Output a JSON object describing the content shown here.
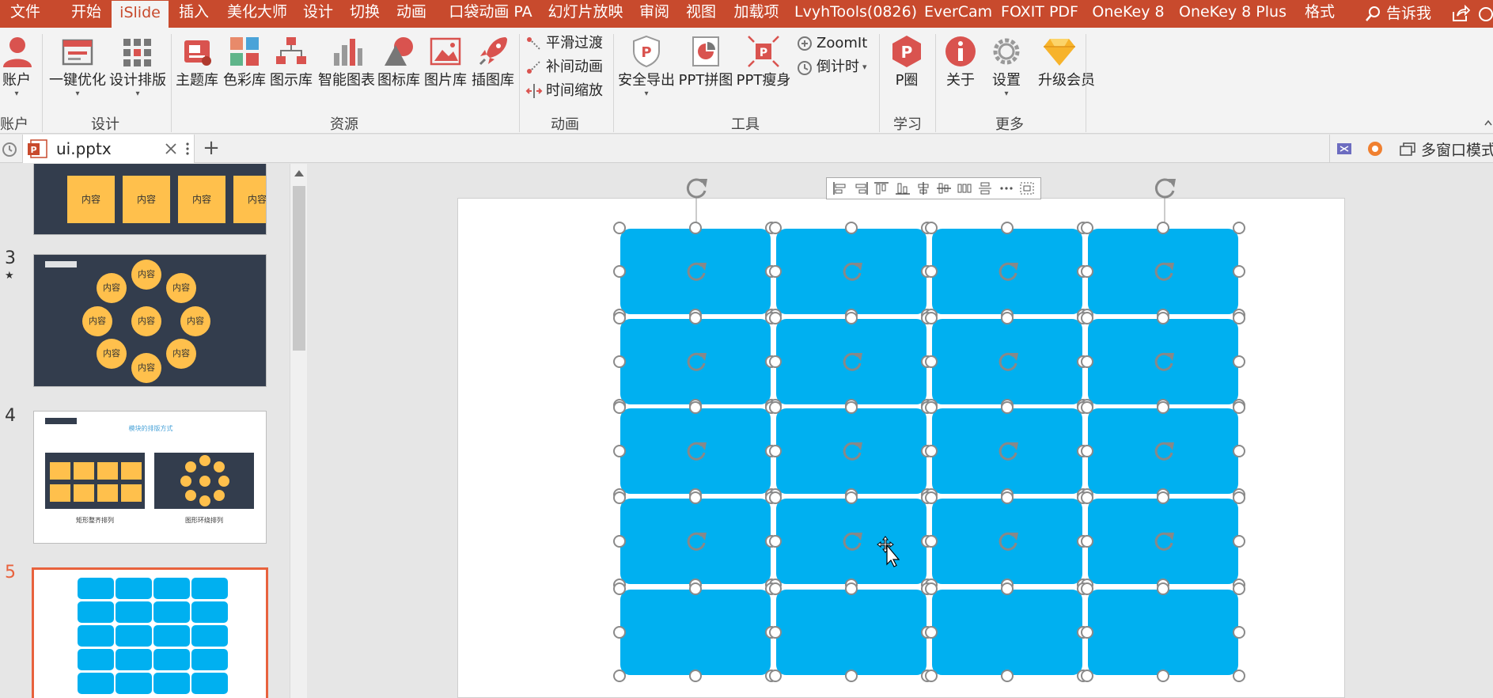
{
  "menu": {
    "tabs": [
      "文件",
      "开始",
      "iSlide",
      "插入",
      "美化大师",
      "设计",
      "切换",
      "动画",
      "口袋动画 PA",
      "幻灯片放映",
      "审阅",
      "视图",
      "加载项",
      "LvyhTools(0826)",
      "EverCam",
      "FOXIT PDF",
      "OneKey 8",
      "OneKey 8 Plus",
      "格式"
    ],
    "active": "iSlide",
    "tell_me": "告诉我"
  },
  "ribbon": {
    "account": {
      "label": "账户",
      "group": "账户"
    },
    "design": {
      "buttons": [
        "一键优化",
        "设计排版"
      ],
      "group": "设计"
    },
    "resources": {
      "buttons": [
        "主题库",
        "色彩库",
        "图示库",
        "智能图表",
        "图标库",
        "图片库",
        "插图库"
      ],
      "group": "资源"
    },
    "animation": {
      "items": [
        "平滑过渡",
        "补间动画",
        "时间缩放"
      ],
      "group": "动画"
    },
    "tools": {
      "buttons": [
        "安全导出",
        "PPT拼图",
        "PPT瘦身"
      ],
      "small": [
        "ZoomIt",
        "倒计时"
      ],
      "group": "工具"
    },
    "learn": {
      "buttons": [
        "P圈"
      ],
      "group": "学习"
    },
    "more": {
      "buttons": [
        "关于",
        "设置",
        "升级会员"
      ],
      "group": "更多"
    }
  },
  "tabbar": {
    "doc_name": "ui.pptx",
    "add": "+",
    "multi_window": "多窗口模式"
  },
  "thumbnails": {
    "content_label": "内容",
    "slides": [
      {
        "num": "3",
        "star": "★"
      },
      {
        "num": "4",
        "title": "模块的排版方式",
        "cap_left": "矩形整齐排列",
        "cap_right": "图形环绕排列"
      },
      {
        "num": "5"
      }
    ]
  },
  "colors": {
    "accent": "#c84a2d",
    "block": "#00b0f0",
    "yellow": "#ffc04c",
    "dark_slide": "#333d4d",
    "selected": "#e8623d"
  }
}
